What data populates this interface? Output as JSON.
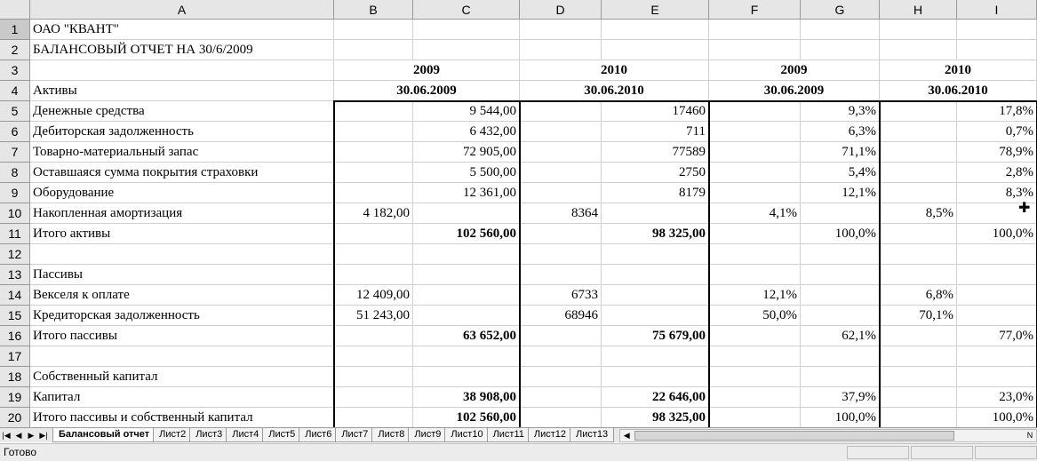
{
  "columns": [
    "A",
    "B",
    "C",
    "D",
    "E",
    "F",
    "G",
    "H",
    "I"
  ],
  "row_numbers": [
    "1",
    "2",
    "3",
    "4",
    "5",
    "6",
    "7",
    "8",
    "9",
    "10",
    "11",
    "12",
    "13",
    "14",
    "15",
    "16",
    "17",
    "18",
    "19",
    "20"
  ],
  "rows": [
    [
      {
        "v": "ОАО \"КВАНТ\""
      },
      {
        "v": ""
      },
      {
        "v": ""
      },
      {
        "v": ""
      },
      {
        "v": ""
      },
      {
        "v": ""
      },
      {
        "v": ""
      },
      {
        "v": ""
      },
      {
        "v": ""
      }
    ],
    [
      {
        "v": "БАЛАНСОВЫЙ ОТЧЕТ НА 30/6/2009"
      },
      {
        "v": ""
      },
      {
        "v": ""
      },
      {
        "v": ""
      },
      {
        "v": ""
      },
      {
        "v": ""
      },
      {
        "v": ""
      },
      {
        "v": ""
      },
      {
        "v": ""
      }
    ],
    [
      {
        "v": ""
      },
      {
        "v": "2009",
        "span": 2,
        "a": "ctr",
        "b": true
      },
      {
        "v": "2010",
        "span": 2,
        "a": "ctr",
        "b": true
      },
      {
        "v": "2009",
        "span": 2,
        "a": "ctr",
        "b": true
      },
      {
        "v": "2010",
        "span": 2,
        "a": "ctr",
        "b": true
      }
    ],
    [
      {
        "v": "Активы"
      },
      {
        "v": "30.06.2009",
        "span": 2,
        "a": "ctr",
        "b": true
      },
      {
        "v": "30.06.2010",
        "span": 2,
        "a": "ctr",
        "b": true
      },
      {
        "v": "30.06.2009",
        "span": 2,
        "a": "ctr",
        "b": true
      },
      {
        "v": "30.06.2010",
        "span": 2,
        "a": "ctr",
        "b": true
      }
    ],
    [
      {
        "v": "Денежные средства"
      },
      {
        "v": ""
      },
      {
        "v": "9 544,00",
        "a": "num"
      },
      {
        "v": ""
      },
      {
        "v": "17460",
        "a": "num"
      },
      {
        "v": ""
      },
      {
        "v": "9,3%",
        "a": "num"
      },
      {
        "v": ""
      },
      {
        "v": "17,8%",
        "a": "num"
      }
    ],
    [
      {
        "v": "Дебиторская задолженность"
      },
      {
        "v": ""
      },
      {
        "v": "6 432,00",
        "a": "num"
      },
      {
        "v": ""
      },
      {
        "v": "711",
        "a": "num"
      },
      {
        "v": ""
      },
      {
        "v": "6,3%",
        "a": "num"
      },
      {
        "v": ""
      },
      {
        "v": "0,7%",
        "a": "num"
      }
    ],
    [
      {
        "v": "Товарно-материальный запас"
      },
      {
        "v": ""
      },
      {
        "v": "72 905,00",
        "a": "num"
      },
      {
        "v": ""
      },
      {
        "v": "77589",
        "a": "num"
      },
      {
        "v": ""
      },
      {
        "v": "71,1%",
        "a": "num"
      },
      {
        "v": ""
      },
      {
        "v": "78,9%",
        "a": "num"
      }
    ],
    [
      {
        "v": "Оставшаяся сумма покрытия страховки"
      },
      {
        "v": ""
      },
      {
        "v": "5 500,00",
        "a": "num"
      },
      {
        "v": ""
      },
      {
        "v": "2750",
        "a": "num"
      },
      {
        "v": ""
      },
      {
        "v": "5,4%",
        "a": "num"
      },
      {
        "v": ""
      },
      {
        "v": "2,8%",
        "a": "num"
      }
    ],
    [
      {
        "v": "Оборудование"
      },
      {
        "v": ""
      },
      {
        "v": "12 361,00",
        "a": "num"
      },
      {
        "v": ""
      },
      {
        "v": "8179",
        "a": "num"
      },
      {
        "v": ""
      },
      {
        "v": "12,1%",
        "a": "num"
      },
      {
        "v": ""
      },
      {
        "v": "8,3%",
        "a": "num"
      }
    ],
    [
      {
        "v": "Накопленная амортизация"
      },
      {
        "v": "4 182,00",
        "a": "num"
      },
      {
        "v": ""
      },
      {
        "v": "8364",
        "a": "num"
      },
      {
        "v": ""
      },
      {
        "v": "4,1%",
        "a": "num"
      },
      {
        "v": ""
      },
      {
        "v": "8,5%",
        "a": "num"
      },
      {
        "v": ""
      }
    ],
    [
      {
        "v": "Итого активы"
      },
      {
        "v": ""
      },
      {
        "v": "102 560,00",
        "a": "num",
        "b": true
      },
      {
        "v": ""
      },
      {
        "v": "98 325,00",
        "a": "num",
        "b": true
      },
      {
        "v": ""
      },
      {
        "v": "100,0%",
        "a": "num"
      },
      {
        "v": ""
      },
      {
        "v": "100,0%",
        "a": "num"
      }
    ],
    [
      {
        "v": ""
      },
      {
        "v": ""
      },
      {
        "v": ""
      },
      {
        "v": ""
      },
      {
        "v": ""
      },
      {
        "v": ""
      },
      {
        "v": ""
      },
      {
        "v": ""
      },
      {
        "v": ""
      }
    ],
    [
      {
        "v": "Пассивы"
      },
      {
        "v": ""
      },
      {
        "v": ""
      },
      {
        "v": ""
      },
      {
        "v": ""
      },
      {
        "v": ""
      },
      {
        "v": ""
      },
      {
        "v": ""
      },
      {
        "v": ""
      }
    ],
    [
      {
        "v": "Векселя к оплате"
      },
      {
        "v": "12 409,00",
        "a": "num"
      },
      {
        "v": ""
      },
      {
        "v": "6733",
        "a": "num"
      },
      {
        "v": ""
      },
      {
        "v": "12,1%",
        "a": "num"
      },
      {
        "v": ""
      },
      {
        "v": "6,8%",
        "a": "num"
      },
      {
        "v": ""
      }
    ],
    [
      {
        "v": "Кредиторская задолженность"
      },
      {
        "v": "51 243,00",
        "a": "num"
      },
      {
        "v": ""
      },
      {
        "v": "68946",
        "a": "num"
      },
      {
        "v": ""
      },
      {
        "v": "50,0%",
        "a": "num"
      },
      {
        "v": ""
      },
      {
        "v": "70,1%",
        "a": "num"
      },
      {
        "v": ""
      }
    ],
    [
      {
        "v": "Итого пассивы"
      },
      {
        "v": ""
      },
      {
        "v": "63 652,00",
        "a": "num",
        "b": true
      },
      {
        "v": ""
      },
      {
        "v": "75 679,00",
        "a": "num",
        "b": true
      },
      {
        "v": ""
      },
      {
        "v": "62,1%",
        "a": "num"
      },
      {
        "v": ""
      },
      {
        "v": "77,0%",
        "a": "num"
      }
    ],
    [
      {
        "v": ""
      },
      {
        "v": ""
      },
      {
        "v": ""
      },
      {
        "v": ""
      },
      {
        "v": ""
      },
      {
        "v": ""
      },
      {
        "v": ""
      },
      {
        "v": ""
      },
      {
        "v": ""
      }
    ],
    [
      {
        "v": "Собственный капитал"
      },
      {
        "v": ""
      },
      {
        "v": ""
      },
      {
        "v": ""
      },
      {
        "v": ""
      },
      {
        "v": ""
      },
      {
        "v": ""
      },
      {
        "v": ""
      },
      {
        "v": ""
      }
    ],
    [
      {
        "v": "Капитал"
      },
      {
        "v": ""
      },
      {
        "v": "38 908,00",
        "a": "num",
        "b": true
      },
      {
        "v": ""
      },
      {
        "v": "22 646,00",
        "a": "num",
        "b": true
      },
      {
        "v": ""
      },
      {
        "v": "37,9%",
        "a": "num"
      },
      {
        "v": ""
      },
      {
        "v": "23,0%",
        "a": "num"
      }
    ],
    [
      {
        "v": "Итого пассивы и собственный капитал"
      },
      {
        "v": ""
      },
      {
        "v": "102 560,00",
        "a": "num",
        "b": true
      },
      {
        "v": ""
      },
      {
        "v": "98 325,00",
        "a": "num",
        "b": true
      },
      {
        "v": ""
      },
      {
        "v": "100,0%",
        "a": "num"
      },
      {
        "v": ""
      },
      {
        "v": "100,0%",
        "a": "num"
      }
    ]
  ],
  "tabs": {
    "nav": [
      "|◀",
      "◀",
      "▶",
      "▶|"
    ],
    "items": [
      "Балансовый отчет",
      "Лист2",
      "Лист3",
      "Лист4",
      "Лист5",
      "Лист6",
      "Лист7",
      "Лист8",
      "Лист9",
      "Лист10",
      "Лист11",
      "Лист12",
      "Лист13"
    ],
    "active_index": 0
  },
  "scroll": {
    "left_arrow": "◀",
    "right_arrow": "N"
  },
  "status": {
    "text": "Готово"
  }
}
